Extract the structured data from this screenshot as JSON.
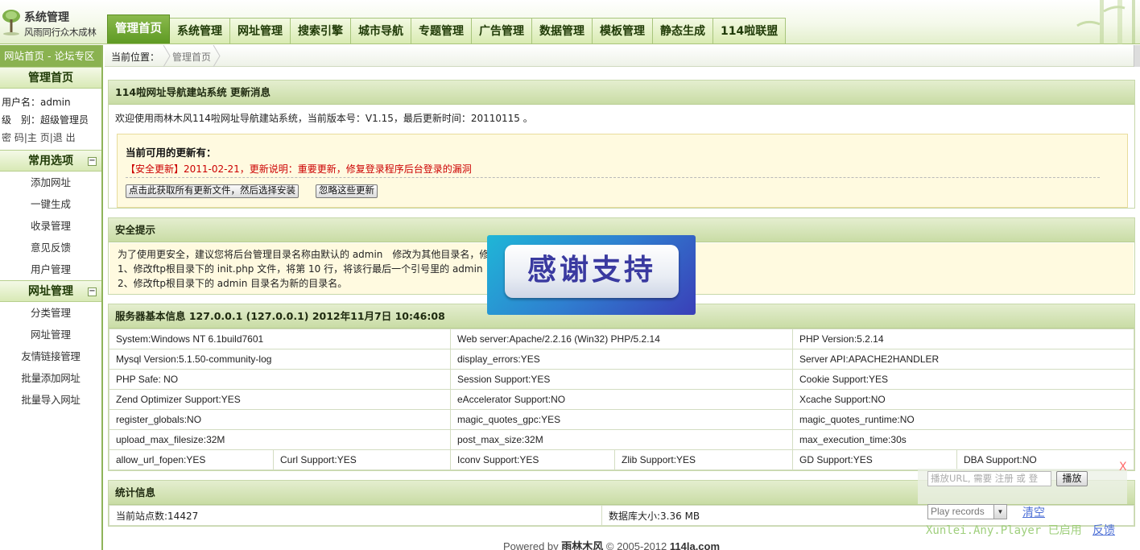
{
  "logo": {
    "title": "系统管理",
    "slogan": "风雨同行众木成林"
  },
  "nav": {
    "tabs": [
      {
        "label": "管理首页",
        "active": true
      },
      {
        "label": "系统管理"
      },
      {
        "label": "网址管理"
      },
      {
        "label": "搜索引擎"
      },
      {
        "label": "城市导航"
      },
      {
        "label": "专题管理"
      },
      {
        "label": "广告管理"
      },
      {
        "label": "数据管理"
      },
      {
        "label": "模板管理"
      },
      {
        "label": "静态生成"
      },
      {
        "label": "114啦联盟"
      }
    ]
  },
  "sidebar": {
    "top_link": "网站首页 - 论坛专区",
    "home_title": "管理首页",
    "user_label": "用户名：admin",
    "level_label": "级　别：超级管理员",
    "links": {
      "password": "密 码",
      "home": "主 页",
      "logout": "退 出",
      "sep": "|"
    },
    "common": {
      "title": "常用选项",
      "items": [
        "添加网址",
        "一键生成",
        "收录管理",
        "意见反馈",
        "用户管理"
      ]
    },
    "url": {
      "title": "网址管理",
      "items": [
        "分类管理",
        "网址管理",
        "友情链接管理",
        "批量添加网址",
        "批量导入网址"
      ]
    }
  },
  "breadcrumb": {
    "label": "当前位置：",
    "current": "管理首页"
  },
  "update_panel": {
    "title": "114啦网址导航建站系统 更新消息",
    "intro": "欢迎使用雨林木风114啦网址导航建站系统，当前版本号：V1.15，最后更新时间：20110115 。",
    "box_title": "当前可用的更新有：",
    "update_line": "【安全更新】2011-02-21，更新说明：重要更新，修复登录程序后台登录的漏洞",
    "btn_get": "点击此获取所有更新文件，然后选择安装",
    "btn_ignore": "忽略这些更新"
  },
  "security_panel": {
    "title": "安全提示",
    "line1": "为了使用更安全，建议您将后台管理目录名称由默认的 admin　修改为其他目录名，修",
    "line2": "1、修改ftp根目录下的 init.php 文件，将第 10 行，将该行最后一个引号里的 admin（小",
    "line3": "2、修改ftp根目录下的 admin 目录名为新的目录名。"
  },
  "server_panel": {
    "title": "服务器基本信息 127.0.0.1 (127.0.0.1)  2012年11月7日 10:46:08",
    "rows": [
      [
        "System:Windows NT 6.1build7601",
        "Web server:Apache/2.2.16 (Win32) PHP/5.2.14",
        "PHP Version:5.2.14"
      ],
      [
        "Mysql Version:5.1.50-community-log",
        "display_errors:YES",
        "Server API:APACHE2HANDLER"
      ],
      [
        "PHP Safe: NO",
        "Session Support:YES",
        "Cookie Support:YES"
      ],
      [
        "Zend Optimizer Support:YES",
        "eAccelerator Support:NO",
        "Xcache Support:NO"
      ],
      [
        "register_globals:NO",
        "magic_quotes_gpc:YES",
        "magic_quotes_runtime:NO"
      ],
      [
        "upload_max_filesize:32M",
        "post_max_size:32M",
        "max_execution_time:30s"
      ]
    ],
    "last_row": [
      "allow_url_fopen:YES",
      "Curl Support:YES",
      "Iconv Support:YES",
      "Zlib Support:YES",
      "GD Support:YES",
      "DBA Support:NO"
    ]
  },
  "stats_panel": {
    "title": "统计信息",
    "sites": "当前站点数:14427",
    "dbsize": "数据库大小:3.36 MB"
  },
  "footer": {
    "prefix": "Powered by ",
    "brand": "雨林木风",
    "copy": " © 2005-2012 ",
    "domain": "114la.com"
  },
  "overlay": {
    "text": "感谢支持"
  },
  "xunlei": {
    "close": "X",
    "url_placeholder": "播放URL, 需要 注册 或 登",
    "play": "播放",
    "records": "Play records",
    "clear": "清空",
    "brand": "Xunlei.Any.Player 已启用",
    "feedback": "反馈"
  },
  "colors": {
    "accent_green": "#8ab250",
    "tab_active": "#5e9a23",
    "alert_red": "#cc0000",
    "note_bg": "#fffae0"
  }
}
